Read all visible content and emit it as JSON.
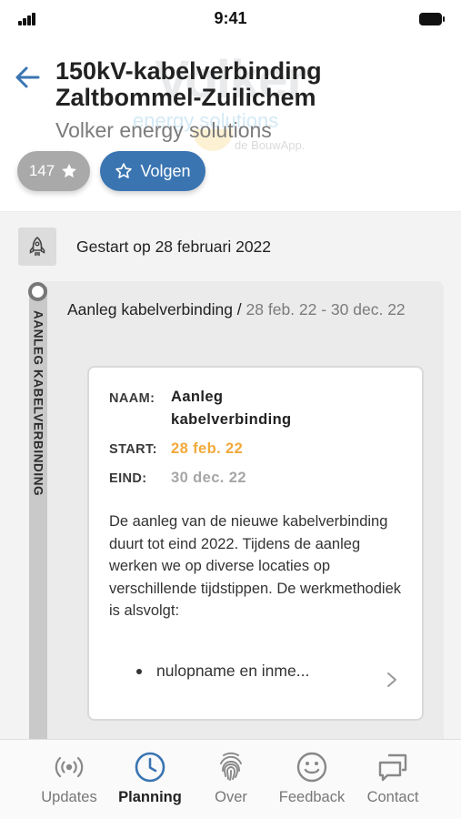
{
  "status_bar": {
    "time": "9:41"
  },
  "header": {
    "title_line1": "150kV-kabelverbinding",
    "title_line2": "Zaltbommel-Zuilichem",
    "subtitle": "Volker energy solutions",
    "watermark": {
      "brand": "Volker",
      "tagline": "energy solutions",
      "app": "de BouwApp."
    },
    "followers_count": "147",
    "follow_label": "Volgen"
  },
  "timeline": {
    "started_text": "Gestart op 28 februari 2022",
    "phase": {
      "vertical_label": "AANLEG KABELVERBINDING",
      "title": "Aanleg kabelverbinding /",
      "dates": " 28 feb. 22 - 30 dec. 22"
    },
    "details": {
      "name_label": "NAAM:",
      "name_value": "Aanleg kabelverbinding",
      "start_label": "START:",
      "start_value": "28 feb. 22",
      "end_label": "EIND:",
      "end_value": "30 dec. 22",
      "description": "De aanleg van de nieuwe kabelverbinding duurt tot eind 2022. Tijdens de aanleg werken we op diverse locaties op verschillende tijdstippen. De werkmethodiek is alsvolgt:",
      "bullet": "nulopname en inme..."
    }
  },
  "bottom_nav": {
    "items": [
      {
        "label": "Updates",
        "icon": "broadcast-icon",
        "active": false
      },
      {
        "label": "Planning",
        "icon": "clock-icon",
        "active": true
      },
      {
        "label": "Over",
        "icon": "fingerprint-icon",
        "active": false
      },
      {
        "label": "Feedback",
        "icon": "smiley-icon",
        "active": false
      },
      {
        "label": "Contact",
        "icon": "chat-icon",
        "active": false
      }
    ]
  },
  "colors": {
    "accent_blue": "#3a75b2",
    "start_orange": "#f1a93a",
    "muted_gray": "#a6a6a6"
  }
}
